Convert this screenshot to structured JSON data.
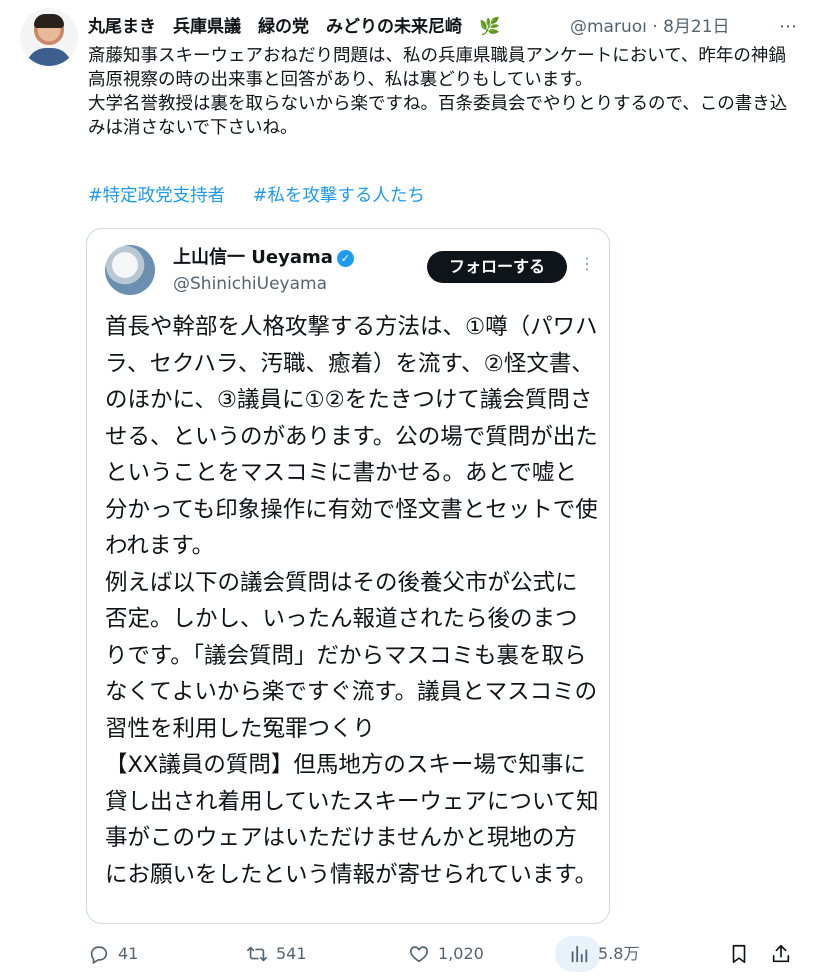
{
  "author": {
    "name": "丸尾まき　兵庫県議　緑の党　みどりの未来尼崎　🌿",
    "handle": "@maruoı",
    "date": "8月21日"
  },
  "tweet": {
    "lines": [
      "斎藤知事スキーウェアおねだり問題は、私の兵庫県職員アンケートにおいて、昨年の神鍋高原視察の時の出来事と回答があり、私は裏どりもしています。",
      "大学名誉教授は裏を取らないから楽ですね。百条委員会でやりとりするので、この書き込みは消さないで下さいね。"
    ],
    "hashtags": [
      "#特定政党支持者",
      "#私を攻撃する人たち"
    ]
  },
  "quote": {
    "name": "上山信一 Ueyama",
    "handle": "@ShinichiUeyama",
    "follow_label": "フォローする",
    "verified_mark": "✓",
    "more": "⋮",
    "paragraphs": [
      "首長や幹部を人格攻撃する方法は、①噂（パワハラ、セクハラ、汚職、癒着）を流す、②怪文書、のほかに、③議員に①②をたきつけて議会質問させる、というのがあります。公の場で質問が出たということをマスコミに書かせる。あとで嘘と分かっても印象操作に有効で怪文書とセットで使われます。",
      "例えば以下の議会質問はその後養父市が公式に否定。しかし、いったん報道されたら後のまつりです。「議会質問」だからマスコミも裏を取らなくてよいから楽ですぐ流す。議員とマスコミの習性を利用した冤罪つくり",
      "【XX議員の質問】但馬地方のスキー場で知事に貸し出され着用していたスキーウェアについて知事がこのウェアはいただけませんかと現地の方にお願いをしたという情報が寄せられています。"
    ]
  },
  "actions": {
    "replies": "41",
    "retweets": "541",
    "likes": "1,020",
    "views": "5.8万"
  },
  "colors": {
    "link": "#1d9bf0",
    "muted": "#536471",
    "text": "#0f1419",
    "border": "#cfd9de"
  },
  "icons": {
    "more": "more-icon",
    "reply": "reply-icon",
    "retweet": "retweet-icon",
    "like": "heart-icon",
    "views": "views-icon",
    "bookmark": "bookmark-icon",
    "share": "share-icon"
  }
}
